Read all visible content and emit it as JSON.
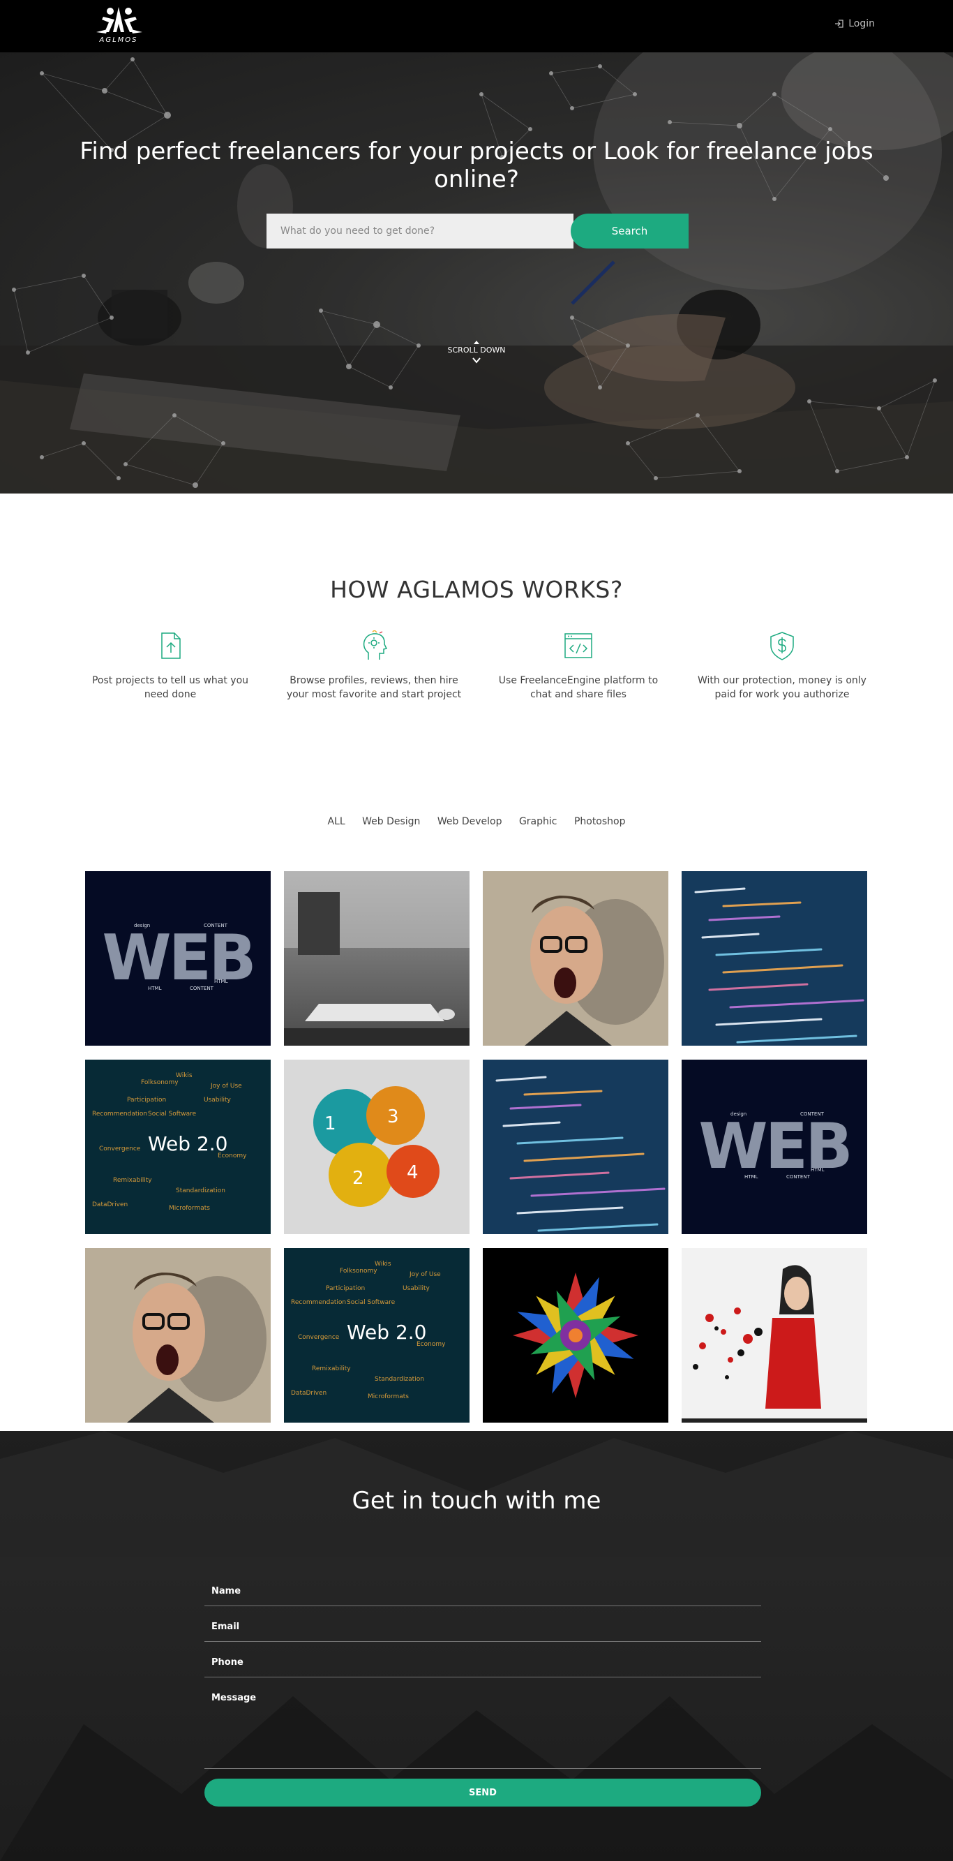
{
  "header": {
    "logo_text": "AGLMOS",
    "login_label": "Login"
  },
  "hero": {
    "title": "Find perfect freelancers for your projects or Look for freelance jobs online?",
    "search_placeholder": "What do you need to get done?",
    "search_button": "Search",
    "scroll_label": "SCROLL DOWN"
  },
  "how": {
    "title": "HOW AGLAMOS WORKS?",
    "steps": [
      {
        "icon": "upload-file-icon",
        "text": "Post projects to tell us what you need done"
      },
      {
        "icon": "head-profile-icon",
        "text": "Browse profiles, reviews, then hire your most favorite and start project"
      },
      {
        "icon": "code-window-icon",
        "text": "Use FreelanceEngine platform to chat and share files"
      },
      {
        "icon": "shield-dollar-icon",
        "text": "With our protection, money is only paid for work you authorize"
      }
    ]
  },
  "portfolio": {
    "tabs": [
      "ALL",
      "Web Design",
      "Web Develop",
      "Graphic",
      "Photoshop"
    ],
    "tiles": [
      {
        "label": "web-wordcloud"
      },
      {
        "label": "keyboard-desk"
      },
      {
        "label": "screaming-man"
      },
      {
        "label": "code-screen"
      },
      {
        "label": "web-2-0-wordcloud",
        "text": "Web 2.0"
      },
      {
        "label": "infographic-steps"
      },
      {
        "label": "code-screen"
      },
      {
        "label": "web-wordcloud"
      },
      {
        "label": "screaming-man"
      },
      {
        "label": "web-2-0-wordcloud",
        "text": "Web 2.0"
      },
      {
        "label": "color-flower"
      },
      {
        "label": "red-dress-woman"
      }
    ]
  },
  "contact": {
    "title": "Get in touch with me",
    "name_label": "Name",
    "email_label": "Email",
    "phone_label": "Phone",
    "message_label": "Message",
    "send_label": "SEND"
  },
  "colors": {
    "accent": "#1daa80",
    "nav_bg": "#000000"
  }
}
